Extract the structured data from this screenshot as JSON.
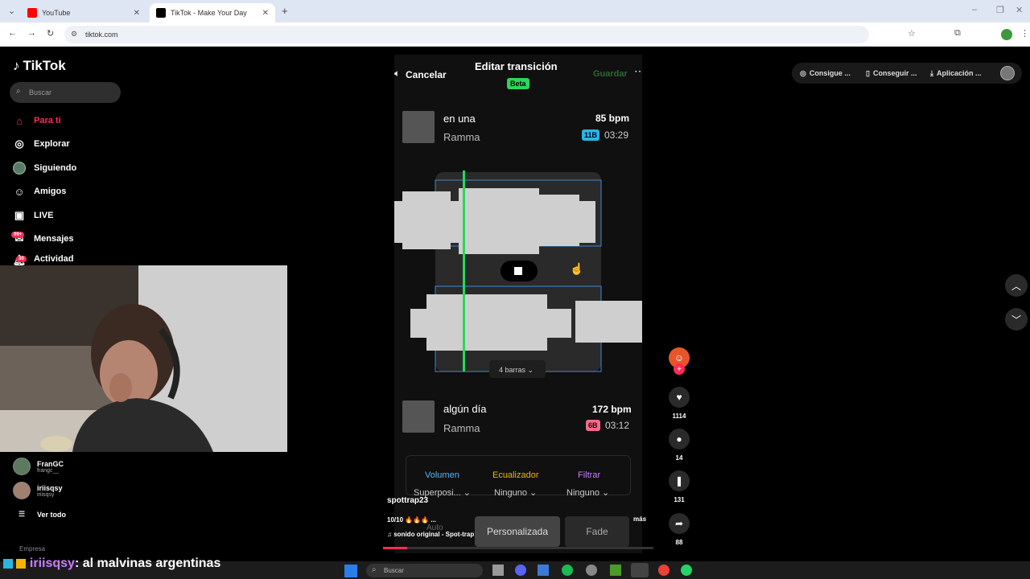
{
  "browser": {
    "tabs": [
      {
        "title": "YouTube",
        "color": "#ff0000"
      },
      {
        "title": "TikTok - Make Your Day",
        "color": "#000000"
      }
    ],
    "url": "tiktok.com"
  },
  "sidebar": {
    "logo": "TikTok",
    "search_placeholder": "Buscar",
    "items": [
      {
        "label": "Para ti",
        "icon": "home-icon"
      },
      {
        "label": "Explorar",
        "icon": "compass-icon"
      },
      {
        "label": "Siguiendo",
        "icon": "avatar-icon"
      },
      {
        "label": "Amigos",
        "icon": "friends-icon"
      },
      {
        "label": "LIVE",
        "icon": "live-icon"
      },
      {
        "label": "Mensajes",
        "icon": "message-icon",
        "badge": "99+"
      },
      {
        "label": "Actividad",
        "icon": "bell-icon",
        "badge": "30"
      }
    ],
    "following": [
      {
        "name": "FranGC",
        "handle": "frangc__"
      },
      {
        "name": "iriisqsy",
        "handle": "iriisqsy"
      }
    ],
    "see_all": "Ver todo",
    "footer": "Empresa"
  },
  "editor": {
    "cancel": "Cancelar",
    "title": "Editar transición",
    "beta": "Beta",
    "save": "Guardar",
    "track1": {
      "title": "en una",
      "artist": "Ramma",
      "bpm": "85 bpm",
      "key": "11B",
      "duration": "03:29"
    },
    "track2": {
      "title": "algún día",
      "artist": "Ramma",
      "bpm": "172 bpm",
      "key": "6B",
      "duration": "03:12"
    },
    "bars": "4 barras",
    "controls": [
      {
        "label": "Volumen",
        "value": "Superposi...",
        "color": "#4fb7ff"
      },
      {
        "label": "Ecualizador",
        "value": "Ninguno",
        "color": "#f4b400"
      },
      {
        "label": "Filtrar",
        "value": "Ninguno",
        "color": "#c77dff"
      }
    ],
    "tabs": [
      "Personalizada",
      "Fade"
    ],
    "fade_left": "Auto"
  },
  "post": {
    "user": "spottrap23",
    "caption": "10/10 🔥🔥🔥 ...",
    "more": "más",
    "sound": "sonido original - Spot-trap",
    "likes": "1114",
    "comments": "14",
    "saves": "131",
    "shares": "88"
  },
  "header": {
    "buttons": [
      "Consigue ...",
      "Conseguir ...",
      "Aplicación ..."
    ]
  },
  "chat": {
    "user": "iriisqsy",
    "message": ": al malvinas argentinas"
  },
  "taskbar": {
    "search": "Buscar"
  }
}
